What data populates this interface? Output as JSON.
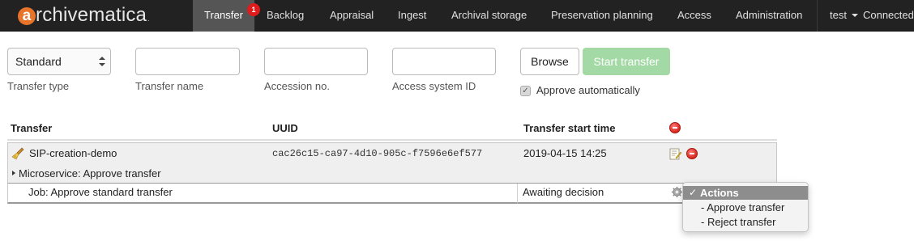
{
  "brand": {
    "name": "archivematica",
    "initial": "a",
    "rest": "rchivematica",
    "tm": "."
  },
  "nav": {
    "items": [
      {
        "label": "Transfer",
        "active": true,
        "badge": "1"
      },
      {
        "label": "Backlog"
      },
      {
        "label": "Appraisal"
      },
      {
        "label": "Ingest"
      },
      {
        "label": "Archival storage"
      },
      {
        "label": "Preservation planning"
      },
      {
        "label": "Access"
      },
      {
        "label": "Administration"
      }
    ],
    "user": "test",
    "status": "Connected"
  },
  "form": {
    "transfer_type": {
      "value": "Standard",
      "label": "Transfer type"
    },
    "transfer_name": {
      "value": "",
      "label": "Transfer name"
    },
    "accession": {
      "value": "",
      "label": "Accession no."
    },
    "access_system_id": {
      "value": "",
      "label": "Access system ID"
    },
    "browse_label": "Browse",
    "start_label": "Start transfer",
    "approve_auto": {
      "label": "Approve automatically",
      "checked": true
    }
  },
  "table": {
    "headers": [
      "Transfer",
      "UUID",
      "Transfer start time"
    ],
    "row": {
      "name": "SIP-creation-demo",
      "uuid": "cac26c15-ca97-4d10-905c-f7596e6ef577",
      "start_time": "2019-04-15 14:25",
      "microservice": "Microservice: Approve transfer",
      "job": "Job: Approve standard transfer",
      "job_status": "Awaiting decision"
    }
  },
  "actions_menu": {
    "items": [
      "Actions",
      "- Approve transfer",
      "- Reject transfer"
    ],
    "selected_index": 0
  },
  "colors": {
    "navbar": "#222222",
    "active_tab": "#555555",
    "badge": "#e01b1b",
    "start_button": "#a3d9a5",
    "brand_accent": "#e8742a"
  },
  "icons": [
    "broom-icon",
    "edit-metadata-icon",
    "remove-icon",
    "gear-icon",
    "checkmark-icon",
    "caret-down-icon"
  ]
}
